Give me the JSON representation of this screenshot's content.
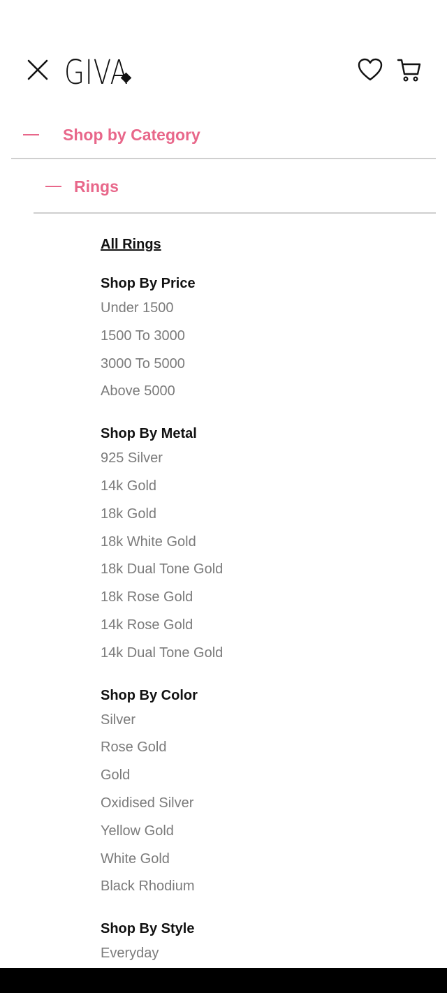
{
  "header": {
    "logo": "GIVA",
    "close_icon": "close-icon",
    "wishlist_icon": "heart-icon",
    "cart_icon": "cart-icon"
  },
  "nav": {
    "category_label": "Shop by Category",
    "subcategory_label": "Rings",
    "accent_color": "#e8678a"
  },
  "menu": {
    "all_link": "All Rings",
    "groups": [
      {
        "title": "Shop By Price",
        "items": [
          "Under 1500",
          "1500 To 3000",
          "3000 To 5000",
          "Above 5000"
        ]
      },
      {
        "title": "Shop By Metal",
        "items": [
          "925 Silver",
          "14k Gold",
          "18k Gold",
          "18k White Gold",
          "18k Dual Tone Gold",
          "18k Rose Gold",
          "14k Rose Gold",
          "14k Dual Tone Gold"
        ]
      },
      {
        "title": "Shop By Color",
        "items": [
          "Silver",
          "Rose Gold",
          "Gold",
          "Oxidised Silver",
          "Yellow Gold",
          "White Gold",
          "Black Rhodium"
        ]
      },
      {
        "title": "Shop By Style",
        "items": [
          "Everyday"
        ]
      }
    ]
  }
}
